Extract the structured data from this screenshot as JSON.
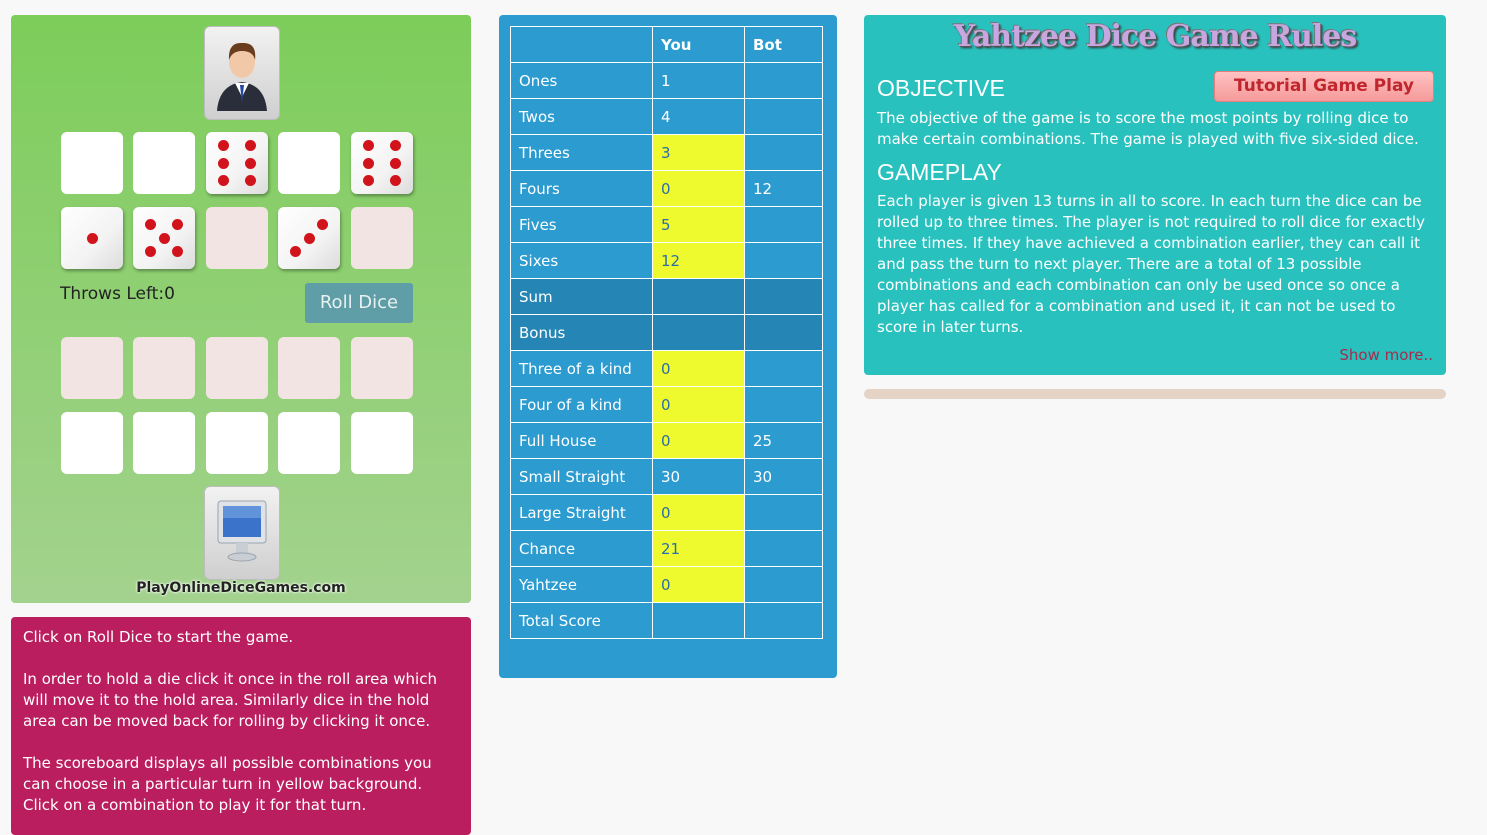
{
  "game": {
    "throws_label": "Throws Left:",
    "throws_left": "0",
    "roll_button_label": "Roll Dice",
    "site_name": "PlayOnlineDiceGames.com",
    "player_dice_row1": [
      null,
      null,
      6,
      null,
      6
    ],
    "player_dice_row2": [
      1,
      5,
      null,
      3,
      null
    ],
    "bot_dice_row1": [
      null,
      null,
      null,
      null,
      null
    ],
    "bot_dice_row2": [
      null,
      null,
      null,
      null,
      null
    ]
  },
  "instructions": {
    "p1": "Click on Roll Dice to start the game.",
    "p2": "In order to hold a die click it once in the roll area which will move it to the hold area. Similarly dice in the hold area can be moved back for rolling by clicking it once.",
    "p3": "The scoreboard displays all possible combinations you can choose in a particular turn in yellow background. Click on a combination to play it for that turn."
  },
  "scoreboard": {
    "headers": [
      "",
      "You",
      "Bot"
    ],
    "rows": [
      {
        "label": "Ones",
        "you": "1",
        "bot": "",
        "available": false,
        "summary": false
      },
      {
        "label": "Twos",
        "you": "4",
        "bot": "",
        "available": false,
        "summary": false
      },
      {
        "label": "Threes",
        "you": "3",
        "bot": "",
        "available": true,
        "summary": false
      },
      {
        "label": "Fours",
        "you": "0",
        "bot": "12",
        "available": true,
        "summary": false
      },
      {
        "label": "Fives",
        "you": "5",
        "bot": "",
        "available": true,
        "summary": false
      },
      {
        "label": "Sixes",
        "you": "12",
        "bot": "",
        "available": true,
        "summary": false
      },
      {
        "label": "Sum",
        "you": "",
        "bot": "",
        "available": false,
        "summary": true
      },
      {
        "label": "Bonus",
        "you": "",
        "bot": "",
        "available": false,
        "summary": true
      },
      {
        "label": "Three of a kind",
        "you": "0",
        "bot": "",
        "available": true,
        "summary": false
      },
      {
        "label": "Four of a kind",
        "you": "0",
        "bot": "",
        "available": true,
        "summary": false
      },
      {
        "label": "Full House",
        "you": "0",
        "bot": "25",
        "available": true,
        "summary": false
      },
      {
        "label": "Small Straight",
        "you": "30",
        "bot": "30",
        "available": false,
        "summary": false
      },
      {
        "label": "Large Straight",
        "you": "0",
        "bot": "",
        "available": true,
        "summary": false
      },
      {
        "label": "Chance",
        "you": "21",
        "bot": "",
        "available": true,
        "summary": false
      },
      {
        "label": "Yahtzee",
        "you": "0",
        "bot": "",
        "available": true,
        "summary": false
      },
      {
        "label": "Total Score",
        "you": "",
        "bot": "",
        "available": false,
        "summary": false
      }
    ],
    "colors": {
      "available": "#eefa2d",
      "normal": "#2b9bd0",
      "summary": "#2585b4"
    }
  },
  "rules": {
    "title": "Yahtzee Dice Game Rules",
    "objective_heading": "OBJECTIVE",
    "tutorial_button": "Tutorial Game Play",
    "objective_text": "The objective of the game is to score the most points by rolling dice to make certain combinations. The game is played with five six-sided dice.",
    "gameplay_heading": "GAMEPLAY",
    "gameplay_text": "Each player is given 13 turns in all to score. In each turn the dice can be rolled up to three times. The player is not required to roll dice for exactly three times. If they have achieved a combination earlier, they can call it and pass the turn to next player. There are a total of 13 possible combinations and each combination can only be used once so once a player has called for a combination and used it, it can not be used to score in later turns.",
    "show_more": "Show more.."
  }
}
